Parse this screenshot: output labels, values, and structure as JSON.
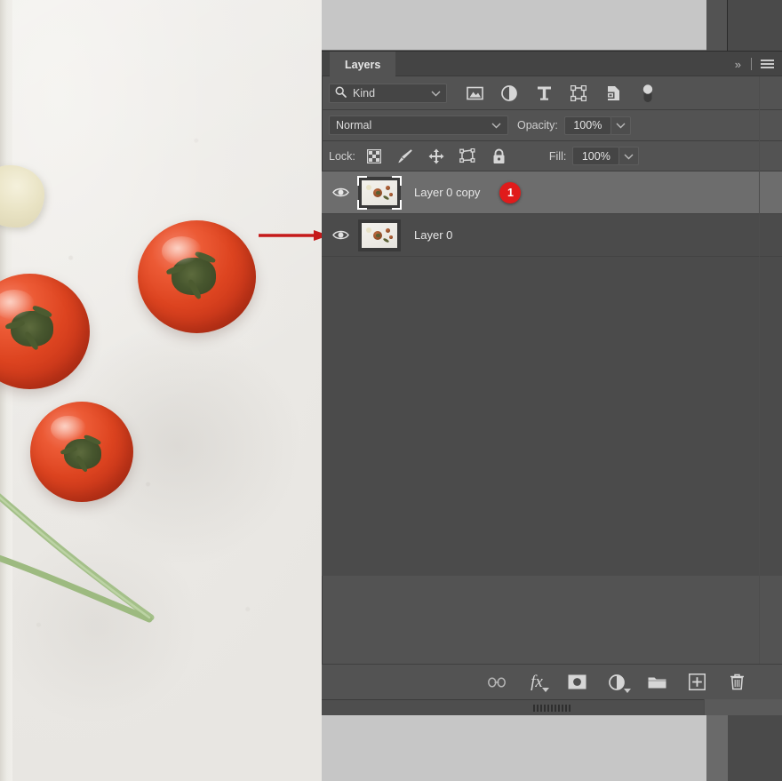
{
  "app": {
    "panel_title": "Layers"
  },
  "panel_header": {
    "collapse_icon": "chevron-double-right-icon",
    "menu_icon": "hamburger-menu-icon"
  },
  "filter_row": {
    "search_icon": "search-icon",
    "kind_label": "Kind",
    "kind_dropdown_icon": "chevron-down-icon",
    "filters": [
      {
        "name": "filter-pixel-layers",
        "icon": "image-icon"
      },
      {
        "name": "filter-adjustment-layers",
        "icon": "adjustment-halfcircle-icon"
      },
      {
        "name": "filter-type-layers",
        "icon": "type-t-icon"
      },
      {
        "name": "filter-shape-layers",
        "icon": "shape-frame-icon"
      },
      {
        "name": "filter-smart-objects",
        "icon": "smart-object-icon"
      },
      {
        "name": "filter-toggle",
        "icon": "toggle-switch-icon"
      }
    ]
  },
  "blend_row": {
    "blend_mode": "Normal",
    "blend_dropdown_icon": "chevron-down-icon",
    "opacity_label": "Opacity:",
    "opacity_value": "100%",
    "opacity_stepper_icon": "chevron-down-icon"
  },
  "lock_row": {
    "lock_label": "Lock:",
    "lock_buttons": [
      {
        "name": "lock-transparent-pixels",
        "icon": "checkerboard-icon"
      },
      {
        "name": "lock-image-pixels",
        "icon": "paintbrush-icon"
      },
      {
        "name": "lock-position",
        "icon": "move-arrows-icon"
      },
      {
        "name": "lock-artboard-nesting",
        "icon": "artboard-icon"
      },
      {
        "name": "lock-all",
        "icon": "padlock-icon"
      }
    ],
    "fill_label": "Fill:",
    "fill_value": "100%",
    "fill_stepper_icon": "chevron-down-icon"
  },
  "layers": [
    {
      "name": "Layer 0 copy",
      "visible": true,
      "selected": true,
      "visibility_icon": "eye-icon",
      "badge": "1"
    },
    {
      "name": "Layer 0",
      "visible": true,
      "selected": false,
      "visibility_icon": "eye-icon",
      "badge": null
    }
  ],
  "bottom_toolbar": [
    {
      "name": "link-layers-button",
      "icon": "link-chain-icon",
      "label": ""
    },
    {
      "name": "layer-style-button",
      "icon": "fx-icon",
      "label": "fx"
    },
    {
      "name": "add-layer-mask-button",
      "icon": "layer-mask-icon",
      "label": ""
    },
    {
      "name": "new-adjustment-layer-button",
      "icon": "adjustment-halfcircle-icon",
      "label": ""
    },
    {
      "name": "new-group-button",
      "icon": "folder-icon",
      "label": ""
    },
    {
      "name": "new-layer-button",
      "icon": "plus-square-icon",
      "label": ""
    },
    {
      "name": "delete-layer-button",
      "icon": "trash-icon",
      "label": ""
    }
  ],
  "annotation": {
    "arrow_icon": "red-arrow-right-icon",
    "arrow_color": "#c51a1a",
    "badge_color": "#e01b1b"
  },
  "photo": {
    "description_icon": "tomatoes-photo",
    "subjects": [
      "tomato",
      "tomato",
      "tomato",
      "garlic-clove",
      "green-onion-stem"
    ]
  },
  "colors": {
    "panel_bg": "#535353",
    "list_bg": "#4b4b4b",
    "selected_row": "#6d6d6d",
    "field_bg": "#454545",
    "text": "#d6d6d6",
    "canvas_bg": "#c6c6c6"
  }
}
